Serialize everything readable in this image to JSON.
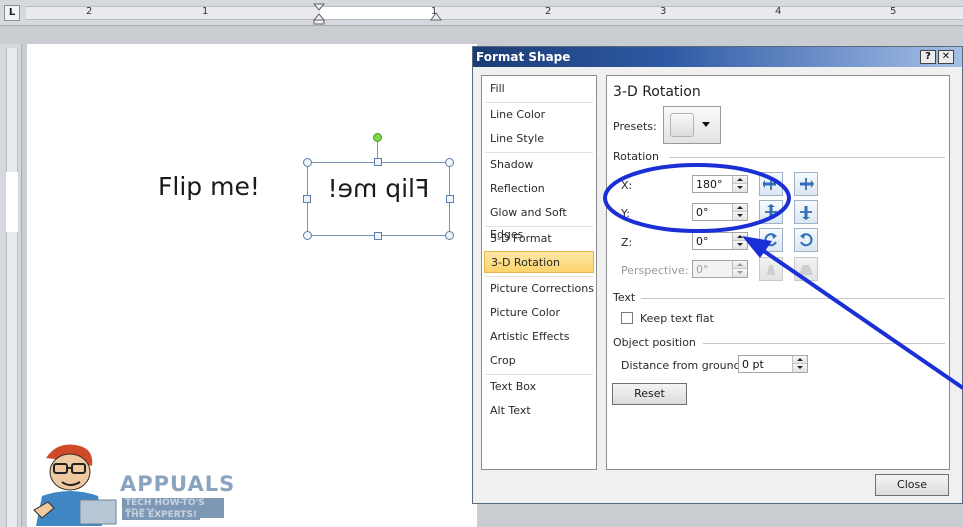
{
  "ruler": {
    "corner_label": "L",
    "numbers": [
      "2",
      "1",
      "1",
      "2",
      "3",
      "4",
      "5"
    ]
  },
  "document": {
    "text": "Flip me!",
    "shape_text": "Flip me!"
  },
  "watermark": {
    "brand": "APPUALS",
    "tagline_1": "TECH HOW-TO'S FROM",
    "tagline_2": "THE EXPERTS!"
  },
  "dialog": {
    "title": "Format Shape",
    "help_label": "?",
    "close_x_label": "✕",
    "nav": [
      {
        "label": "Fill",
        "selected": false
      },
      {
        "label": "Line Color",
        "selected": false
      },
      {
        "label": "Line Style",
        "selected": false
      },
      {
        "label": "Shadow",
        "selected": false
      },
      {
        "label": "Reflection",
        "selected": false
      },
      {
        "label": "Glow and Soft Edges",
        "selected": false
      },
      {
        "label": "3-D Format",
        "selected": false
      },
      {
        "label": "3-D Rotation",
        "selected": true
      },
      {
        "label": "Picture Corrections",
        "selected": false
      },
      {
        "label": "Picture Color",
        "selected": false
      },
      {
        "label": "Artistic Effects",
        "selected": false
      },
      {
        "label": "Crop",
        "selected": false
      },
      {
        "label": "Text Box",
        "selected": false
      },
      {
        "label": "Alt Text",
        "selected": false
      }
    ],
    "section_title": "3-D Rotation",
    "presets_label": "Presets:",
    "rotation_group": "Rotation",
    "x": {
      "label": "X:",
      "value": "180°"
    },
    "y": {
      "label": "Y:",
      "value": "0°"
    },
    "z": {
      "label": "Z:",
      "value": "0°"
    },
    "perspective": {
      "label": "Perspective:",
      "value": "0°"
    },
    "text_group": "Text",
    "keep_text_flat_label": "Keep text flat",
    "keep_text_flat_checked": false,
    "object_position_group": "Object position",
    "distance_label": "Distance from ground:",
    "distance_value": "0 pt",
    "reset_label": "Reset",
    "close_label": "Close"
  },
  "colors": {
    "title_bar": "#2f5aa4",
    "selected_item": "#fbd46b",
    "annotation": "#1a2fd6"
  }
}
